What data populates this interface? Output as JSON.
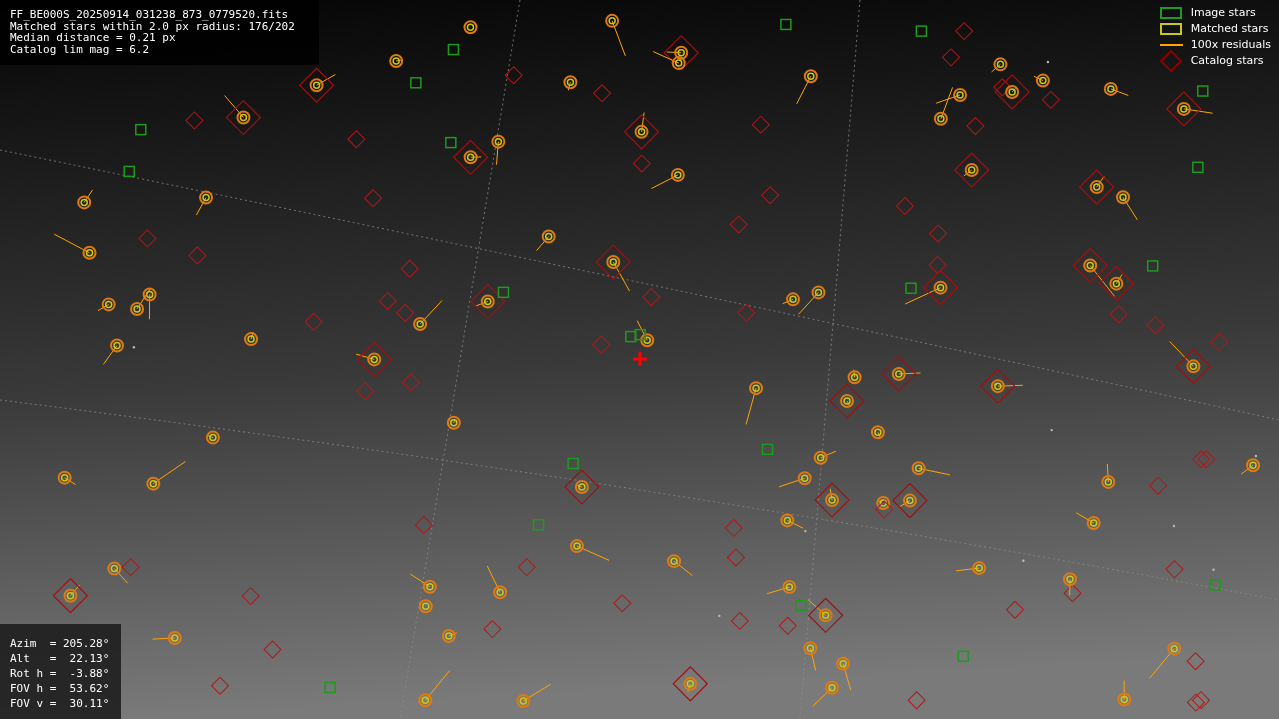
{
  "info_panel": {
    "lines": [
      "FF_BE000S_20250914_031238_873_0779520.fits",
      "Matched stars within 2.0 px radius: 176/202",
      "Median distance = 0.21 px",
      "Catalog lim mag = 6.2"
    ]
  },
  "pointing_panel": {
    "lines": [
      "Azim  = 205.28°",
      "Alt   =  22.13°",
      "Rot h =  -3.88°",
      "FOV h =  53.62°",
      "FOV v =  30.11°"
    ]
  },
  "legend": {
    "items": [
      {
        "kind": "box",
        "color": "#1e9a1e",
        "label": "Image stars"
      },
      {
        "kind": "box",
        "color": "#c8c81e",
        "label": "Matched stars"
      },
      {
        "kind": "line",
        "color": "#ffa500",
        "label": "100x residuals"
      },
      {
        "kind": "diamond",
        "color": "#8b0000",
        "label": "Catalog stars"
      }
    ]
  }
}
